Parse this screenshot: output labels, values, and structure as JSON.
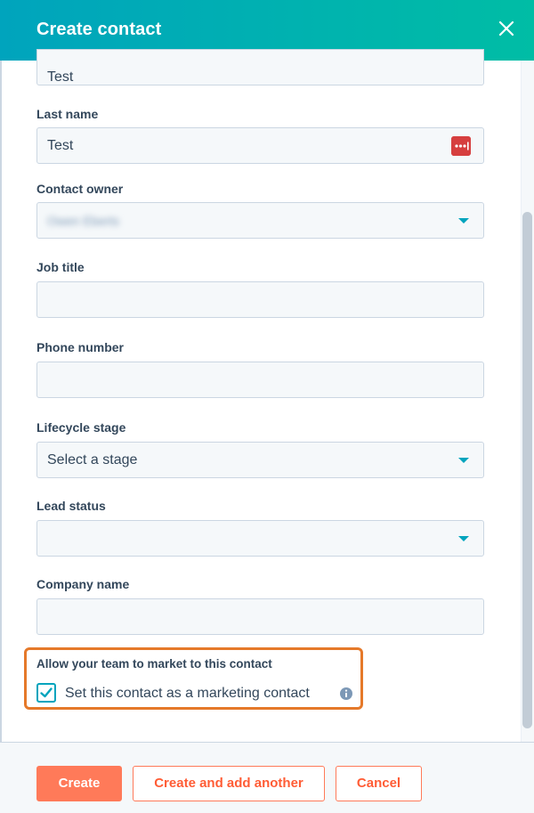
{
  "header": {
    "title": "Create contact"
  },
  "fields": {
    "first_name": {
      "value": "Test"
    },
    "last_name": {
      "label": "Last name",
      "value": "Test"
    },
    "contact_owner": {
      "label": "Contact owner",
      "value": "Owen Eberts"
    },
    "job_title": {
      "label": "Job title",
      "value": ""
    },
    "phone_number": {
      "label": "Phone number",
      "value": ""
    },
    "lifecycle_stage": {
      "label": "Lifecycle stage",
      "value": "Select a stage"
    },
    "lead_status": {
      "label": "Lead status",
      "value": ""
    },
    "company_name": {
      "label": "Company name",
      "value": ""
    }
  },
  "marketing": {
    "heading": "Allow your team to market to this contact",
    "checkbox_label": "Set this contact as a marketing contact",
    "checked": true
  },
  "footer": {
    "create_label": "Create",
    "create_another_label": "Create and add another",
    "cancel_label": "Cancel"
  },
  "colors": {
    "header_gradient_start": "#00a4bd",
    "header_gradient_end": "#00bda5",
    "primary_button": "#ff7a59",
    "highlight_border": "#e5792a",
    "dropdown_caret": "#00a4bd"
  },
  "icons": [
    "close-icon",
    "password-manager-icon",
    "dropdown-caret-icon",
    "checkmark-icon",
    "info-icon"
  ]
}
